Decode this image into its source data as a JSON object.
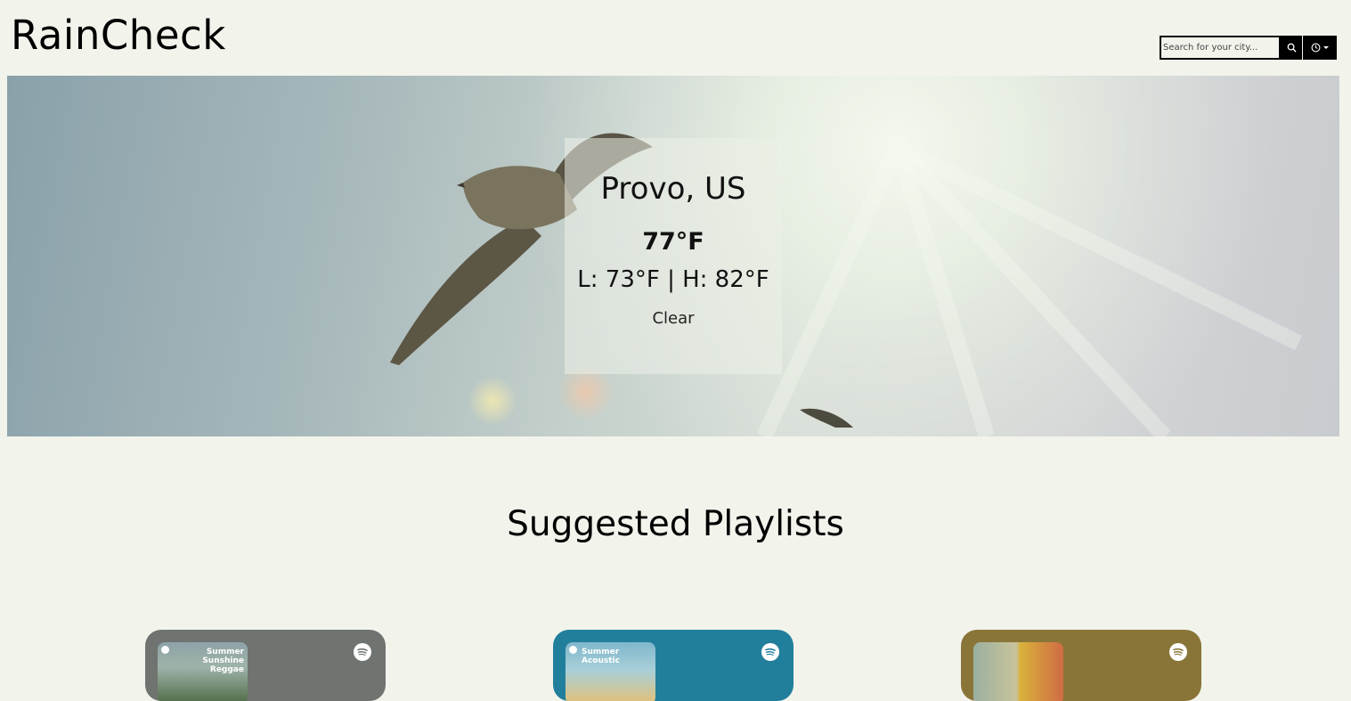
{
  "app": {
    "title": "RainCheck"
  },
  "search": {
    "placeholder": "Search for your city...",
    "button_icon": "search-icon",
    "history_icon": "clock-icon"
  },
  "weather": {
    "city": "Provo, US",
    "temperature": "77°F",
    "range": "L: 73°F | H: 82°F",
    "condition": "Clear"
  },
  "playlists_section": {
    "title": "Suggested Playlists",
    "cards": [
      {
        "cover_label": "Summer Sunshine Reggae",
        "color": "#6f7470",
        "icon": "spotify-icon"
      },
      {
        "cover_label": "Summer Acoustic",
        "color": "#227f9c",
        "icon": "spotify-icon"
      },
      {
        "cover_label": "",
        "color": "#8a7538",
        "icon": "spotify-icon"
      }
    ]
  },
  "colors": {
    "background": "#f2f4ec",
    "header_buttons": "#000000"
  }
}
